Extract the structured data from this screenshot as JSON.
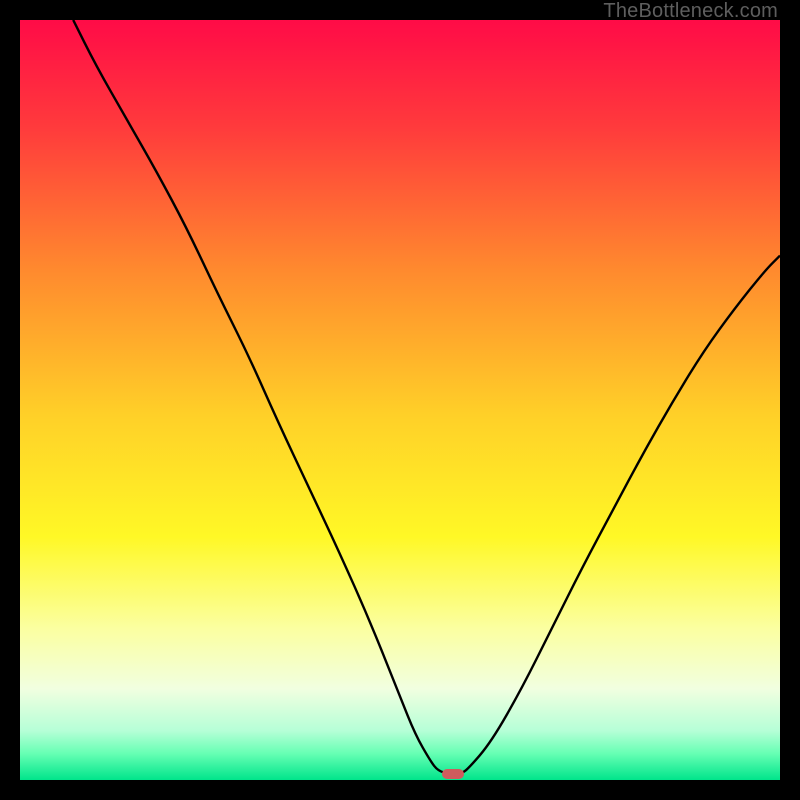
{
  "watermark": "TheBottleneck.com",
  "chart_data": {
    "type": "line",
    "title": "",
    "xlabel": "",
    "ylabel": "",
    "xlim": [
      0,
      100
    ],
    "ylim": [
      0,
      100
    ],
    "grid": false,
    "legend": false,
    "background_gradient_stops": [
      {
        "pct": 0,
        "color": "#ff0b47"
      },
      {
        "pct": 14,
        "color": "#ff3a3c"
      },
      {
        "pct": 33,
        "color": "#ff8a2e"
      },
      {
        "pct": 52,
        "color": "#ffd028"
      },
      {
        "pct": 68,
        "color": "#fff826"
      },
      {
        "pct": 80,
        "color": "#fbffa0"
      },
      {
        "pct": 88,
        "color": "#f1ffe0"
      },
      {
        "pct": 93.5,
        "color": "#b6ffd7"
      },
      {
        "pct": 96.5,
        "color": "#67ffb4"
      },
      {
        "pct": 100,
        "color": "#00e58b"
      }
    ],
    "series": [
      {
        "name": "bottleneck-curve",
        "color": "#000000",
        "x": [
          7,
          10,
          14,
          18,
          22,
          26,
          30,
          34,
          38,
          42,
          46,
          50,
          52,
          54,
          55,
          56.5,
          58,
          59,
          62,
          66,
          70,
          74,
          78,
          82,
          86,
          90,
          94,
          98,
          100
        ],
        "y": [
          100,
          94,
          87,
          80,
          72.5,
          64,
          56,
          47,
          38.5,
          30,
          21,
          11,
          6,
          2.5,
          1.2,
          0.8,
          0.8,
          1.5,
          5,
          12,
          20,
          28,
          35.5,
          43,
          50,
          56.5,
          62,
          67,
          69
        ]
      }
    ],
    "marker": {
      "x": 57,
      "y": 0.8,
      "color": "#cf5b5d",
      "shape": "pill"
    }
  }
}
